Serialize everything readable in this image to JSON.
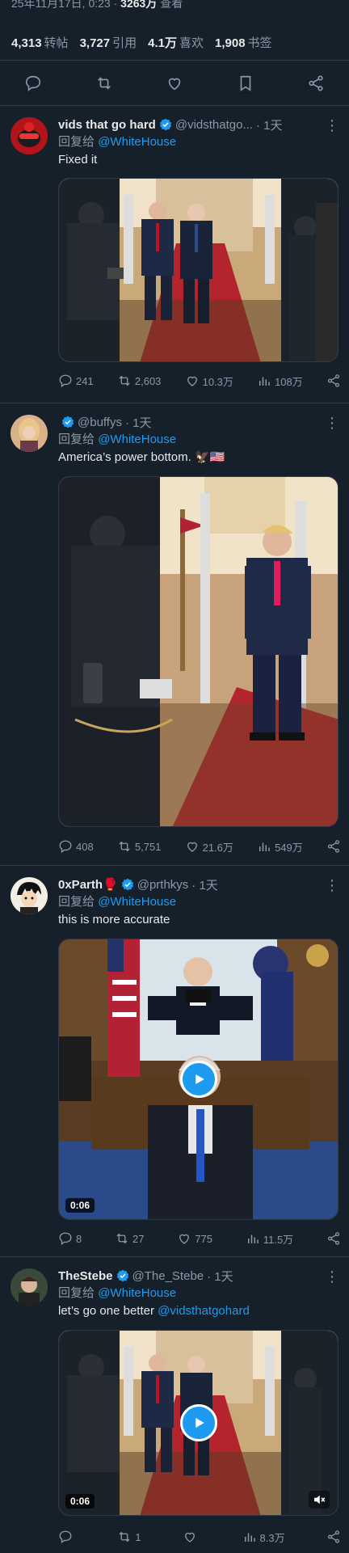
{
  "post_meta": {
    "timestamp_fragment": "25年11月17日, 0:23",
    "views": "3263万",
    "views_label": "查看"
  },
  "stats": [
    {
      "value": "4,313",
      "label": "转帖"
    },
    {
      "value": "3,727",
      "label": "引用"
    },
    {
      "value": "4.1万",
      "label": "喜欢"
    },
    {
      "value": "1,908",
      "label": "书签"
    }
  ],
  "main_actions": [
    "reply-icon",
    "retweet-icon",
    "like-icon",
    "bookmark-icon",
    "share-icon"
  ],
  "replies": [
    {
      "name": "vids that go hard",
      "verified": true,
      "handle": "@vidsthatgo...",
      "time": "· 1天",
      "reply_prefix": "回复给",
      "reply_to": "@WhiteHouse",
      "text": "Fixed it",
      "media_type": "image",
      "counts": {
        "replies": "241",
        "retweets": "2,603",
        "likes": "10.3万",
        "views": "108万"
      }
    },
    {
      "name": "",
      "verified": true,
      "handle": "@buffys",
      "time": "· 1天",
      "reply_prefix": "回复给",
      "reply_to": "@WhiteHouse",
      "text": "America’s power bottom. 🦅🇺🇸",
      "media_type": "image",
      "counts": {
        "replies": "408",
        "retweets": "5,751",
        "likes": "21.6万",
        "views": "549万"
      }
    },
    {
      "name": "0xParth🥊",
      "verified": true,
      "handle": "@prthkys",
      "time": "· 1天",
      "reply_prefix": "回复给",
      "reply_to": "@WhiteHouse",
      "text": "this is more accurate",
      "media_type": "video",
      "duration": "0:06",
      "counts": {
        "replies": "8",
        "retweets": "27",
        "likes": "775",
        "views": "11.5万"
      }
    },
    {
      "name": "TheStebe",
      "verified": true,
      "handle": "@The_Stebe",
      "time": "· 1天",
      "reply_prefix": "回复给",
      "reply_to": "@WhiteHouse",
      "text_prefix": "let’s go one better",
      "text_mention": "@vidsthatgohard",
      "media_type": "video",
      "duration": "0:06",
      "counts": {
        "replies": "",
        "retweets": "1",
        "likes": "",
        "views": "8.3万"
      }
    }
  ],
  "colors": {
    "background": "#15202b",
    "accent": "#1d9bf0",
    "muted": "#8b98a5",
    "text": "#e7e9ea"
  }
}
